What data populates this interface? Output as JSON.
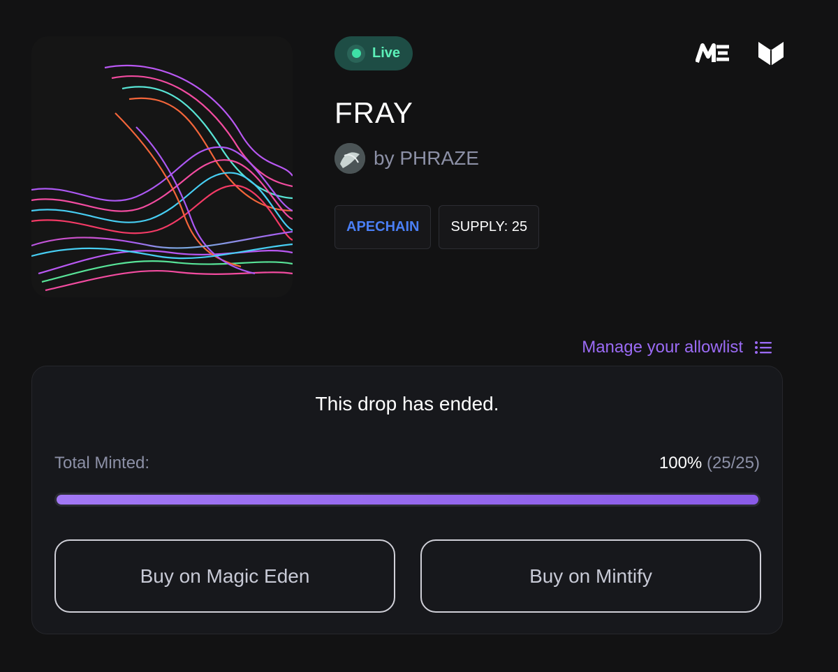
{
  "status": {
    "label": "Live",
    "color": "#3ee0a6"
  },
  "brand_icons": [
    "magic-eden-logo-icon",
    "mintify-logo-icon"
  ],
  "collection": {
    "title": "FRAY",
    "creator": "by PHRAZE",
    "tags": {
      "chain": "APECHAIN",
      "supply": "SUPPLY: 25"
    }
  },
  "allowlist": {
    "label": "Manage your allowlist",
    "icon": "list-icon"
  },
  "drop": {
    "status_text": "This drop has ended.",
    "minted_label": "Total Minted:",
    "minted_percent": "100%",
    "minted_count": "(25/25)",
    "progress": 1.0
  },
  "actions": {
    "buy_magic_eden": "Buy on Magic Eden",
    "buy_mintify": "Buy on Mintify"
  },
  "colors": {
    "accent": "#9b6bf5",
    "chain": "#4a7ff5",
    "background": "#121213"
  }
}
